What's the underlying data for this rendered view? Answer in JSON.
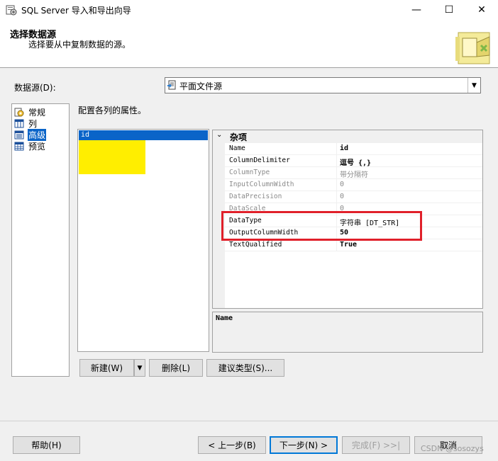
{
  "window": {
    "title": "SQL Server 导入和导出向导",
    "minimize": "—",
    "maximize": "☐",
    "close": "✕"
  },
  "header": {
    "title": "选择数据源",
    "subtitle": "选择要从中复制数据的源。"
  },
  "datasource": {
    "label": "数据源(D):",
    "value": "平面文件源",
    "arrow": "▼"
  },
  "nav": {
    "items": [
      {
        "label": "常规",
        "icon": "general-icon",
        "selected": false
      },
      {
        "label": "列",
        "icon": "columns-icon",
        "selected": false
      },
      {
        "label": "高级",
        "icon": "advanced-icon",
        "selected": true
      },
      {
        "label": "预览",
        "icon": "preview-icon",
        "selected": false
      }
    ]
  },
  "config_label": "配置各列的属性。",
  "columns": {
    "selected": "id"
  },
  "properties": {
    "category": "杂项",
    "category_toggle": "⌄",
    "rows": [
      {
        "name": "Name",
        "value": "id"
      },
      {
        "name": "ColumnDelimiter",
        "value": "逗号 {,}"
      },
      {
        "name": "ColumnType",
        "value": "带分隔符"
      },
      {
        "name": "InputColumnWidth",
        "value": "0"
      },
      {
        "name": "DataPrecision",
        "value": "0"
      },
      {
        "name": "DataScale",
        "value": "0"
      },
      {
        "name": "DataType",
        "value": "字符串 [DT_STR]"
      },
      {
        "name": "OutputColumnWidth",
        "value": "50"
      },
      {
        "name": "TextQualified",
        "value": "True"
      }
    ]
  },
  "description": {
    "title": "Name"
  },
  "buttons": {
    "new": "新建(W)",
    "new_arrow": "▼",
    "delete": "删除(L)",
    "suggest": "建议类型(S)...",
    "help": "帮助(H)",
    "back": "< 上一步(B)",
    "next": "下一步(N) >",
    "finish": "完成(F) >>|",
    "cancel": "取消"
  },
  "watermark": "CSDN @sosozys",
  "colors": {
    "selection": "#0a64c8",
    "highlight": "#ffee00",
    "annotation": "#e0202a"
  }
}
